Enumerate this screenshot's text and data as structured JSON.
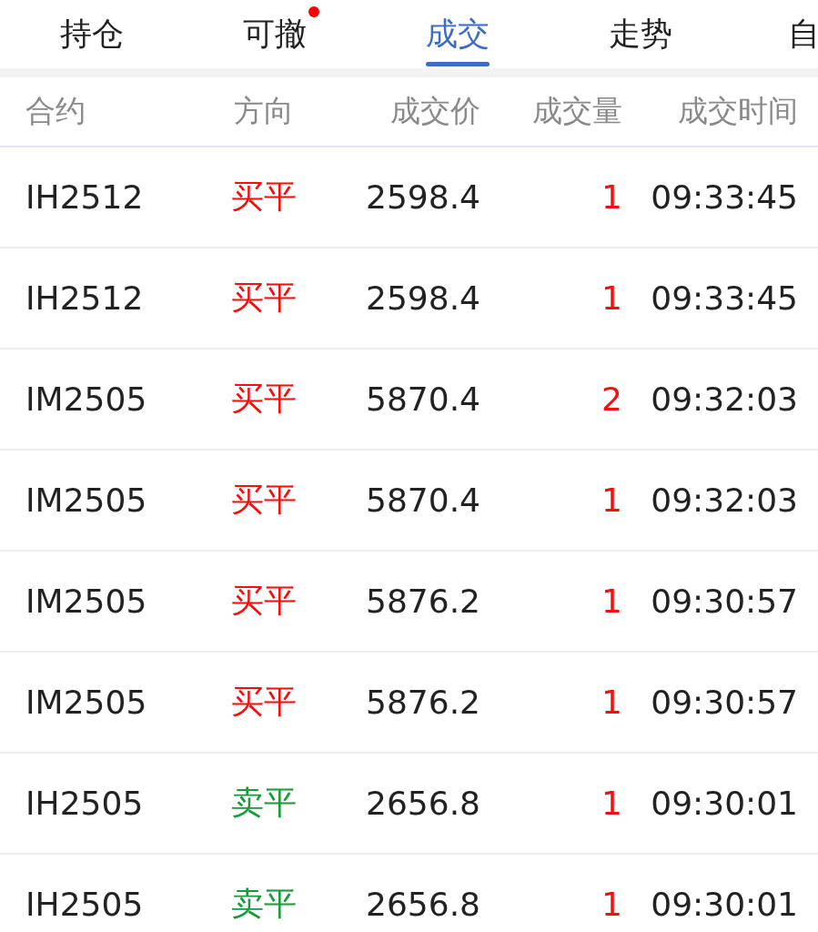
{
  "tabs": [
    {
      "label": "持仓",
      "selected": false,
      "badge": false
    },
    {
      "label": "可撤",
      "selected": false,
      "badge": true
    },
    {
      "label": "成交",
      "selected": true,
      "badge": false
    },
    {
      "label": "走势",
      "selected": false,
      "badge": false
    },
    {
      "label": "自",
      "selected": false,
      "badge": false
    }
  ],
  "table": {
    "columns": [
      "合约",
      "方向",
      "成交价",
      "成交量",
      "成交时间"
    ],
    "rows": [
      {
        "contract": "IH2512",
        "direction": "买平",
        "kind": "buy",
        "price": "2598.4",
        "volume": "1",
        "time": "09:33:45"
      },
      {
        "contract": "IH2512",
        "direction": "买平",
        "kind": "buy",
        "price": "2598.4",
        "volume": "1",
        "time": "09:33:45"
      },
      {
        "contract": "IM2505",
        "direction": "买平",
        "kind": "buy",
        "price": "5870.4",
        "volume": "2",
        "time": "09:32:03"
      },
      {
        "contract": "IM2505",
        "direction": "买平",
        "kind": "buy",
        "price": "5870.4",
        "volume": "1",
        "time": "09:32:03"
      },
      {
        "contract": "IM2505",
        "direction": "买平",
        "kind": "buy",
        "price": "5876.2",
        "volume": "1",
        "time": "09:30:57"
      },
      {
        "contract": "IM2505",
        "direction": "买平",
        "kind": "buy",
        "price": "5876.2",
        "volume": "1",
        "time": "09:30:57"
      },
      {
        "contract": "IH2505",
        "direction": "卖平",
        "kind": "sell",
        "price": "2656.8",
        "volume": "1",
        "time": "09:30:01"
      },
      {
        "contract": "IH2505",
        "direction": "卖平",
        "kind": "sell",
        "price": "2656.8",
        "volume": "1",
        "time": "09:30:01"
      }
    ]
  }
}
